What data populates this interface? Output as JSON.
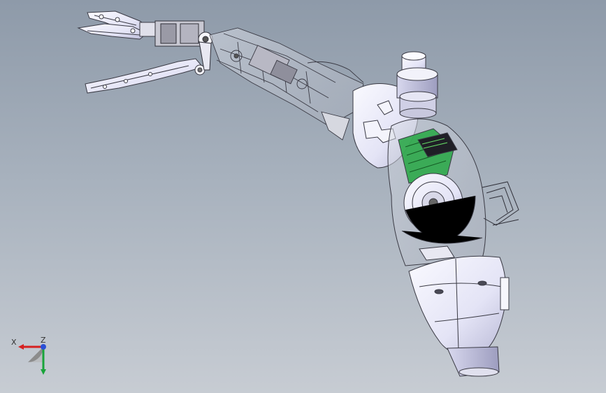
{
  "viewport": {
    "background_top": "#8e9aa9",
    "background_bottom": "#c7ccd3"
  },
  "model": {
    "shell_color": "#eeeefa",
    "shell_shadow": "#c4c4dc",
    "wire_color": "#3a3a44",
    "circuit_color": "#2ea84a"
  },
  "triad": {
    "x_label": "X",
    "z_label": "Z",
    "x_color": "#d62020",
    "y_color": "#18a43a",
    "z_color": "#2a4fd6"
  }
}
